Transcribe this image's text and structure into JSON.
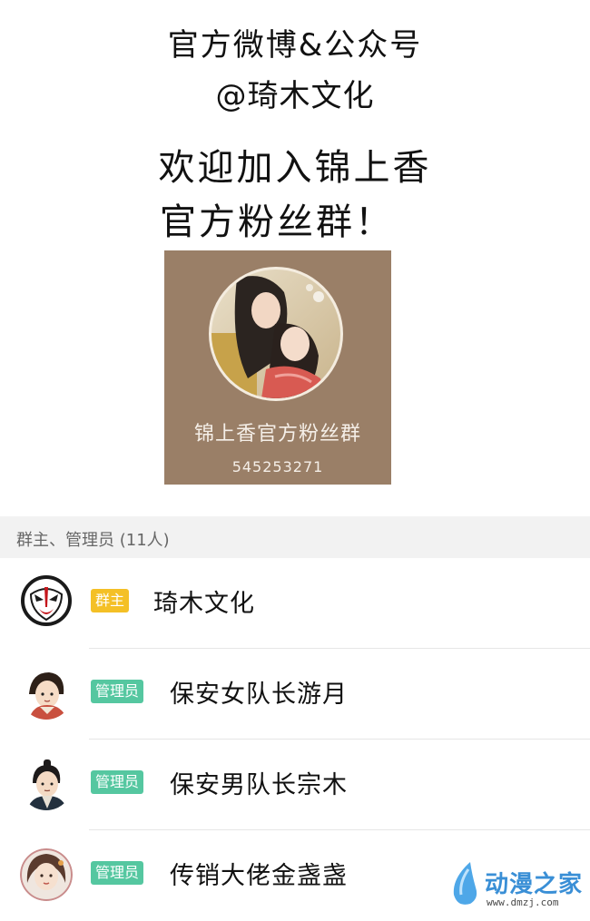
{
  "header": {
    "line1": "官方微博&公众号",
    "line2": "@琦木文化",
    "line3": "欢迎加入锦上香",
    "line4": "官方粉丝群！"
  },
  "group_card": {
    "name": "锦上香官方粉丝群",
    "id": "545253271",
    "bg_color": "#9a7f67"
  },
  "section": {
    "title": "群主、管理员 (11人)"
  },
  "members": [
    {
      "badge": "群主",
      "badge_type": "owner",
      "name": "琦木文化",
      "avatar": "opera-mask-avatar"
    },
    {
      "badge": "管理员",
      "badge_type": "admin",
      "name": "保安女队长游月",
      "avatar": "cartoon-girl-avatar"
    },
    {
      "badge": "管理员",
      "badge_type": "admin",
      "name": "保安男队长宗木",
      "avatar": "cartoon-boy-avatar"
    },
    {
      "badge": "管理员",
      "badge_type": "admin",
      "name": "传销大佬金盏盏",
      "avatar": "cartoon-lady-avatar"
    }
  ],
  "watermark": {
    "text": "动漫之家",
    "url": "www.dmzj.com"
  },
  "colors": {
    "owner_badge": "#f4c026",
    "admin_badge": "#55c7a0",
    "watermark": "#3a8fd6"
  }
}
